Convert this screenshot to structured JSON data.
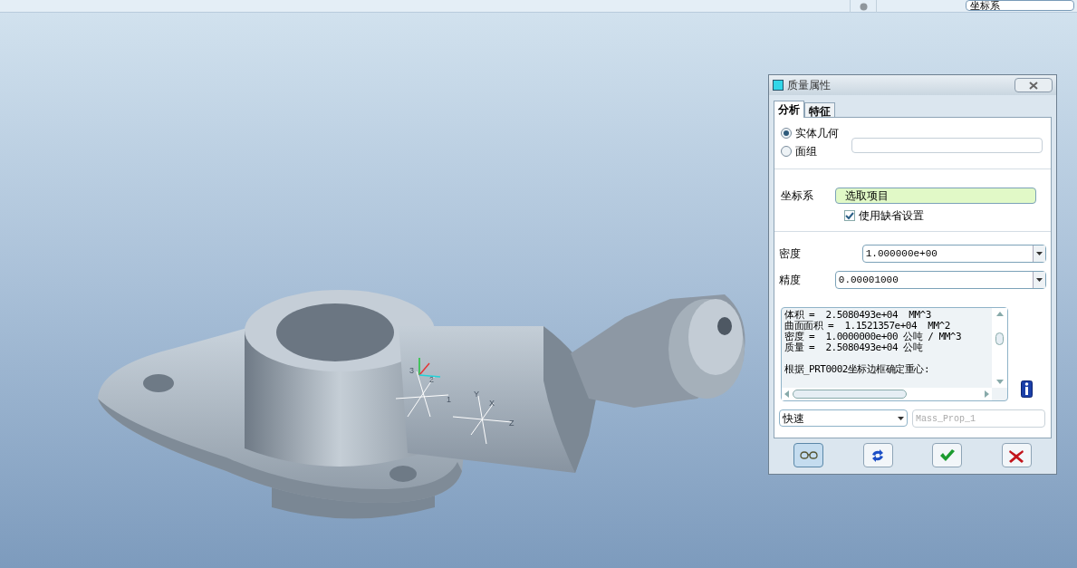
{
  "toolbar": {
    "field_value": "坐标系"
  },
  "viewport": {
    "axis_labels": [
      "3",
      "2",
      "1",
      "Y",
      "X",
      "Z"
    ]
  },
  "dialog": {
    "title": "质量属性",
    "tabs": [
      {
        "label": "分析",
        "selected": true
      },
      {
        "label": "特征",
        "selected": false
      }
    ],
    "geometry_options": [
      {
        "label": "实体几何",
        "selected": true
      },
      {
        "label": "面组",
        "selected": false
      }
    ],
    "coord_label": "坐标系",
    "coord_select": "选取项目",
    "use_default": {
      "label": "使用缺省设置",
      "checked": true
    },
    "density": {
      "label": "密度",
      "value": "1.000000e+00"
    },
    "precision": {
      "label": "精度",
      "value": "0.00001000"
    },
    "results": [
      "体积 =  2.5080493e+04  MM^3",
      "曲面面积 =  1.1521357e+04  MM^2",
      "密度 =  1.0000000e+00 公吨 / MM^3",
      "质量 =  2.5080493e+04 公吨"
    ],
    "results_note": "根据_PRT0002坐标边框确定重心:",
    "mode": "快速",
    "name_placeholder": "Mass_Prop_1",
    "buttons": [
      {
        "kind": "preview",
        "selected": true
      },
      {
        "kind": "repeat",
        "selected": false
      },
      {
        "kind": "ok",
        "selected": false
      },
      {
        "kind": "cancel",
        "selected": false
      }
    ]
  }
}
